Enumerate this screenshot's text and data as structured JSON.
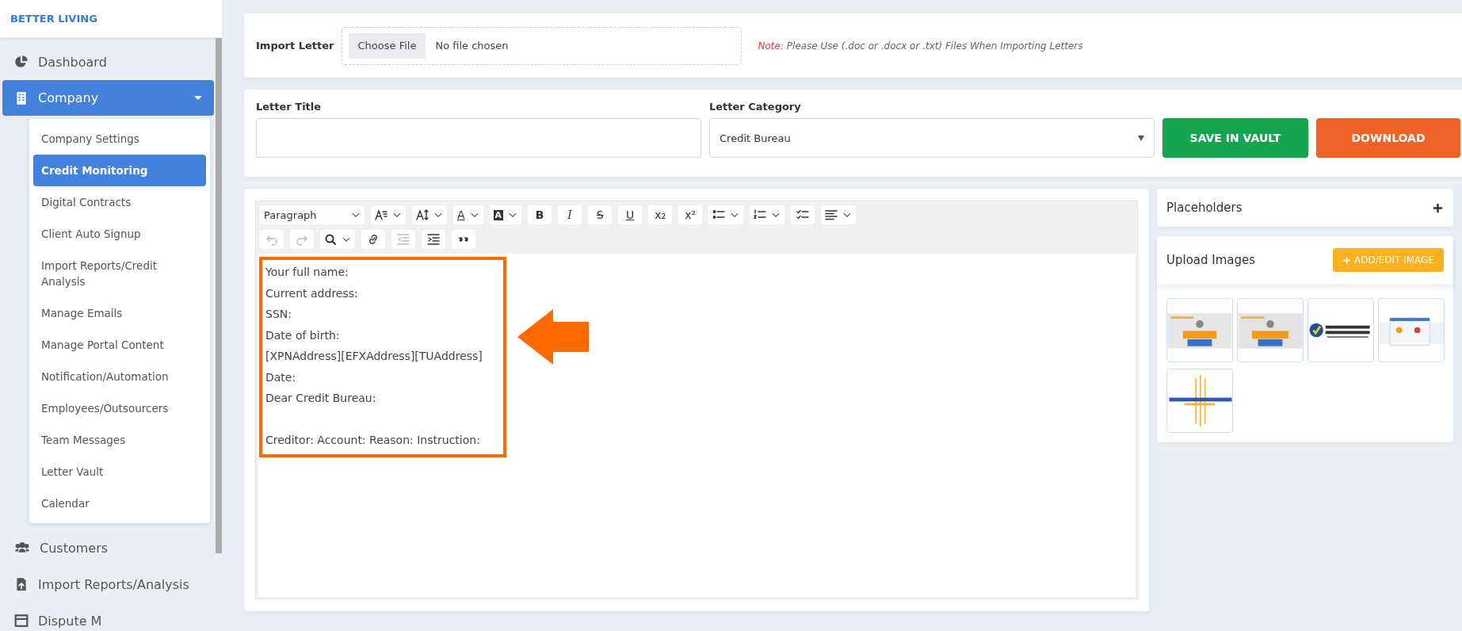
{
  "sidebar": {
    "brand": "BETTER LIVING",
    "items": [
      {
        "label": "Dashboard",
        "kind": "dashboard",
        "selected": false
      },
      {
        "label": "Company",
        "kind": "company",
        "selected": true,
        "expanded": true,
        "children": [
          {
            "label": "Company Settings",
            "selected": false
          },
          {
            "label": "Credit Monitoring",
            "selected": true
          },
          {
            "label": "Digital Contracts",
            "selected": false
          },
          {
            "label": "Client Auto Signup",
            "selected": false
          },
          {
            "label": "Import Reports/Credit Analysis",
            "selected": false
          },
          {
            "label": "Manage Emails",
            "selected": false
          },
          {
            "label": "Manage Portal Content",
            "selected": false
          },
          {
            "label": "Notification/Automation",
            "selected": false
          },
          {
            "label": "Employees/Outsourcers",
            "selected": false
          },
          {
            "label": "Team Messages",
            "selected": false
          },
          {
            "label": "Letter Vault",
            "selected": false
          },
          {
            "label": "Calendar",
            "selected": false
          }
        ]
      },
      {
        "label": "Customers",
        "kind": "customers",
        "selected": false
      },
      {
        "label": "Import Reports/Analysis",
        "kind": "import",
        "selected": false
      },
      {
        "label": "Dispute M",
        "kind": "dispute",
        "selected": false
      }
    ]
  },
  "import": {
    "label": "Import Letter",
    "button": "Choose File",
    "status": "No file chosen",
    "note_label": "Note:",
    "note": "Please Use (.doc or .docx or .txt) Files When Importing Letters"
  },
  "letter": {
    "title_label": "Letter Title",
    "category_label": "Letter Category",
    "category": "Credit Bureau",
    "save_button": "SAVE IN VAULT",
    "download_button": "DOWNLOAD"
  },
  "editor": {
    "toolbar": [
      [
        {
          "kind": "select",
          "text": "Paragraph",
          "dropdown": true,
          "disabled": false
        },
        {
          "kind": "fontsize",
          "dropdown": true,
          "disabled": false
        },
        {
          "kind": "lineheight",
          "dropdown": true,
          "disabled": false
        },
        {
          "kind": "fontcolor",
          "text": "A",
          "dropdown": true,
          "disabled": false
        },
        {
          "kind": "highlight",
          "text": "A",
          "dropdown": true,
          "disabled": false
        },
        {
          "kind": "bold",
          "text": "B",
          "dropdown": false,
          "disabled": false
        },
        {
          "kind": "italic",
          "text": "I",
          "dropdown": false,
          "disabled": false
        },
        {
          "kind": "strike",
          "text": "S",
          "dropdown": false,
          "disabled": false
        },
        {
          "kind": "underline",
          "text": "U",
          "dropdown": false,
          "disabled": false
        },
        {
          "kind": "sub",
          "text": "x₂",
          "dropdown": false,
          "disabled": false
        },
        {
          "kind": "sup",
          "text": "x²",
          "dropdown": false,
          "disabled": false
        },
        {
          "kind": "bullets",
          "dropdown": true,
          "disabled": false
        },
        {
          "kind": "numbers",
          "dropdown": true,
          "disabled": false
        },
        {
          "kind": "checklist",
          "dropdown": false,
          "disabled": false
        },
        {
          "kind": "align",
          "dropdown": true,
          "disabled": false
        }
      ],
      [
        {
          "kind": "undo",
          "dropdown": false,
          "disabled": true
        },
        {
          "kind": "redo",
          "dropdown": false,
          "disabled": true
        },
        {
          "kind": "find",
          "dropdown": true,
          "disabled": false
        },
        {
          "kind": "link",
          "dropdown": false,
          "disabled": false
        },
        {
          "kind": "outdent",
          "dropdown": false,
          "disabled": true
        },
        {
          "kind": "indent",
          "dropdown": false,
          "disabled": false
        },
        {
          "kind": "quote",
          "dropdown": false,
          "disabled": false
        }
      ]
    ],
    "lines": [
      {
        "text": "Your full name:",
        "space_before": false
      },
      {
        "text": "Current address:",
        "space_before": false
      },
      {
        "text": "SSN:",
        "space_before": false
      },
      {
        "text": "Date of birth:",
        "space_before": false
      },
      {
        "text": "[XPNAddress][EFXAddress][TUAddress]",
        "space_before": false
      },
      {
        "text": "Date:",
        "space_before": false
      },
      {
        "text": "Dear Credit Bureau:",
        "space_before": false
      },
      {
        "text": "Creditor: Account: Reason: Instruction:",
        "space_before": true
      }
    ]
  },
  "placeholders": {
    "title": "Placeholders"
  },
  "upload": {
    "title": "Upload Images",
    "button": "ADD/EDIT IMAGE"
  }
}
